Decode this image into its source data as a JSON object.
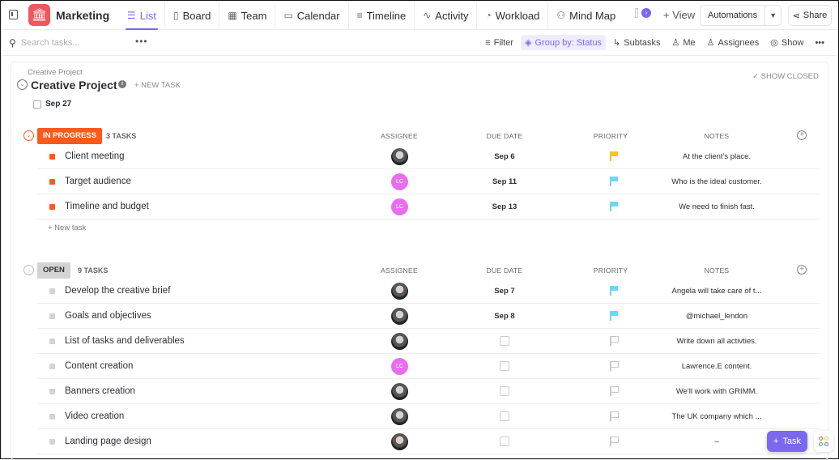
{
  "header": {
    "title": "Marketing",
    "tabs": [
      {
        "label": "List",
        "icon": "list-icon"
      },
      {
        "label": "Board",
        "icon": "board-icon"
      },
      {
        "label": "Team",
        "icon": "team-icon"
      },
      {
        "label": "Calendar",
        "icon": "calendar-icon"
      },
      {
        "label": "Timeline",
        "icon": "timeline-icon"
      },
      {
        "label": "Activity",
        "icon": "activity-icon"
      },
      {
        "label": "Workload",
        "icon": "workload-icon"
      },
      {
        "label": "Mind Map",
        "icon": "mind-map-icon"
      }
    ],
    "add_view": "+ View",
    "automations": "Automations",
    "share": "Share"
  },
  "toolbar": {
    "search_placeholder": "Search tasks...",
    "filter": "Filter",
    "group_by": "Group by: Status",
    "subtasks": "Subtasks",
    "me": "Me",
    "assignees": "Assignees",
    "show": "Show"
  },
  "project": {
    "breadcrumb": "Creative Project",
    "title": "Creative Project",
    "new_task": "+ NEW TASK",
    "show_closed": "SHOW CLOSED",
    "date": "Sep 27"
  },
  "columns": {
    "assignee": "ASSIGNEE",
    "due": "DUE DATE",
    "priority": "PRIORITY",
    "notes": "NOTES"
  },
  "colors": {
    "accent": "#7b68ee",
    "in_progress": "#fc5a1b",
    "urgent_flag": "#f5c518",
    "normal_flag": "#6fd6f2",
    "avatar_lc": "#e86ef0"
  },
  "groups": [
    {
      "status": "IN PROGRESS",
      "count": "3 TASKS",
      "color": "#fc5a1b",
      "tasks": [
        {
          "name": "Client meeting",
          "assignee": "photo",
          "due": "Sep 6",
          "priority": "urgent",
          "notes": "At the client's place."
        },
        {
          "name": "Target audience",
          "assignee": "LC",
          "due": "Sep 11",
          "priority": "normal",
          "notes": "Who is the ideal customer."
        },
        {
          "name": "Timeline and budget",
          "assignee": "LC",
          "due": "Sep 13",
          "priority": "normal",
          "notes": "We need to finish fast."
        }
      ],
      "new_task": "+ New task"
    },
    {
      "status": "OPEN",
      "count": "9 TASKS",
      "color": "#d3d3d3",
      "tasks": [
        {
          "name": "Develop the creative brief",
          "assignee": "photo",
          "due": "Sep 7",
          "priority": "normal",
          "notes": "Angela will take care of t..."
        },
        {
          "name": "Goals and objectives",
          "assignee": "photo",
          "due": "Sep 8",
          "priority": "normal",
          "notes": "@michael_lendon"
        },
        {
          "name": "List of tasks and deliverables",
          "assignee": "photo",
          "due": "",
          "priority": "none",
          "notes": "Write down all activties."
        },
        {
          "name": "Content creation",
          "assignee": "LC",
          "due": "",
          "priority": "none",
          "notes": "Lawrence.E content."
        },
        {
          "name": "Banners creation",
          "assignee": "photo",
          "due": "",
          "priority": "none",
          "notes": "We'll work with GRIMM."
        },
        {
          "name": "Video creation",
          "assignee": "photo",
          "due": "",
          "priority": "none",
          "notes": "The UK company which ..."
        },
        {
          "name": "Landing page design",
          "assignee": "photo",
          "due": "",
          "priority": "none",
          "notes": "–"
        }
      ]
    }
  ],
  "fab": {
    "label": "Task"
  }
}
